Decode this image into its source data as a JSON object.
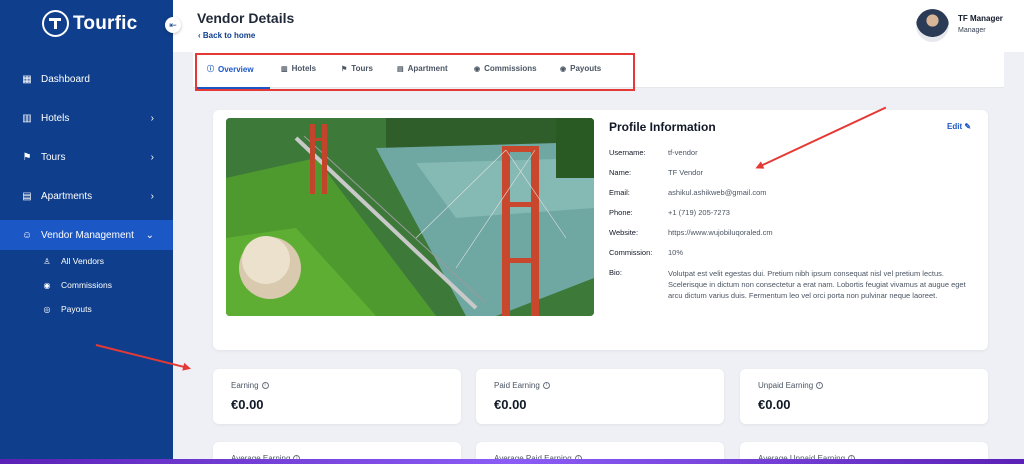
{
  "brand": {
    "name": "Tourfic"
  },
  "sidebar": {
    "items": [
      {
        "label": "Dashboard",
        "icon": "dashboard-icon"
      },
      {
        "label": "Hotels",
        "icon": "hotel-icon",
        "has_children": true
      },
      {
        "label": "Tours",
        "icon": "flag-icon",
        "has_children": true
      },
      {
        "label": "Apartments",
        "icon": "apartment-icon",
        "has_children": true
      },
      {
        "label": "Vendor Management",
        "icon": "users-icon",
        "expanded": true
      }
    ],
    "sub_items": [
      {
        "label": "All Vendors",
        "icon": "user-icon"
      },
      {
        "label": "Commissions",
        "icon": "coin-icon"
      },
      {
        "label": "Payouts",
        "icon": "payout-icon"
      }
    ]
  },
  "header": {
    "title": "Vendor Details",
    "back_label": "Back to home",
    "user_name": "TF Manager",
    "user_role": "Manager"
  },
  "tabs": [
    {
      "label": "Overview",
      "active": true
    },
    {
      "label": "Hotels"
    },
    {
      "label": "Tours"
    },
    {
      "label": "Apartment"
    },
    {
      "label": "Commissions"
    },
    {
      "label": "Payouts"
    }
  ],
  "profile": {
    "title": "Profile Information",
    "edit_label": "Edit",
    "fields": [
      {
        "label": "Username:",
        "value": "tf-vendor"
      },
      {
        "label": "Name:",
        "value": "TF Vendor"
      },
      {
        "label": "Email:",
        "value": "ashikul.ashikweb@gmail.com"
      },
      {
        "label": "Phone:",
        "value": "+1 (719) 205-7273"
      },
      {
        "label": "Website:",
        "value": "https://www.wujobiluqoraled.cm"
      },
      {
        "label": "Commission:",
        "value": "10%"
      }
    ],
    "bio_label": "Bio:",
    "bio": "Volutpat est velit egestas dui. Pretium nibh ipsum consequat nisl vel pretium lectus. Scelerisque in dictum non consectetur a erat nam. Lobortis feugiat vivamus at augue eget arcu dictum varius duis. Fermentum leo vel orci porta non pulvinar neque laoreet."
  },
  "stats": [
    {
      "label": "Earning",
      "value": "€0.00"
    },
    {
      "label": "Paid Earning",
      "value": "€0.00"
    },
    {
      "label": "Unpaid Earning",
      "value": "€0.00"
    },
    {
      "label": "Average Earning",
      "value": ""
    },
    {
      "label": "Average Paid Earning",
      "value": ""
    },
    {
      "label": "Average Unpaid Earning",
      "value": ""
    }
  ],
  "colors": {
    "sidebar": "#0f3f8c",
    "accent": "#1c57c6",
    "annotation": "#e53935"
  }
}
